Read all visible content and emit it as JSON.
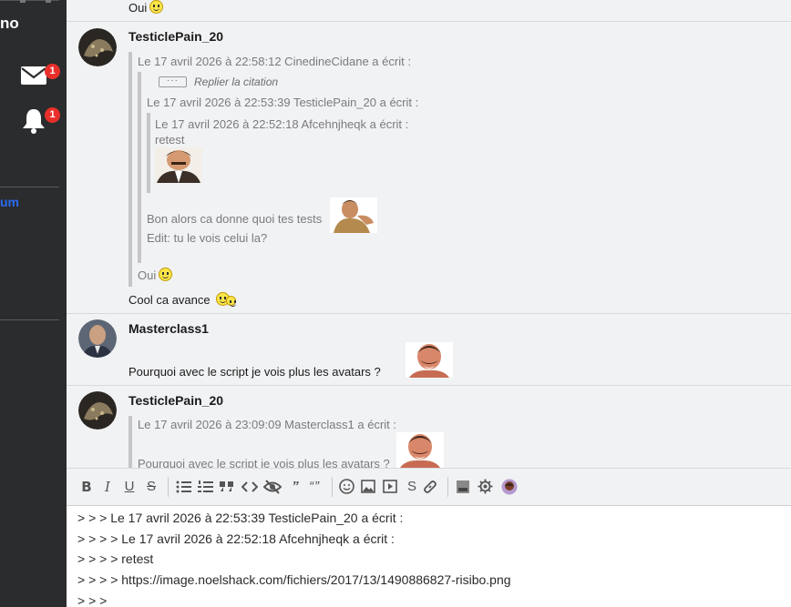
{
  "sidebar": {
    "title": "no",
    "mail_badge": "1",
    "notif_badge": "1",
    "link_label": "um"
  },
  "messages": [
    {
      "tail_text": "Oui"
    },
    {
      "author": "TesticlePain_20",
      "quote1_header": "Le 17 avril 2026 à 22:58:12 CinedineCidane a écrit :",
      "collapse_label": "Replier la citation",
      "collapse_button": "···",
      "quote2_header": "Le 17 avril 2026 à 22:53:39 TesticlePain_20 a écrit :",
      "quote3_header": "Le 17 avril 2026 à 22:52:18 Afcehnjheqk a écrit :",
      "quote3_text": "retest",
      "quote2_line1": "Bon alors ca donne quoi tes tests",
      "quote2_line2": "Edit: tu le vois celui la?",
      "quote1_tail": "Oui",
      "body": "Cool ca avance"
    },
    {
      "author": "Masterclass1",
      "body": "Pourquoi avec le script je vois plus les avatars ?"
    },
    {
      "author": "TesticlePain_20",
      "quote_header": "Le 17 avril 2026 à 23:09:09 Masterclass1 a écrit :",
      "quote_text": "Pourquoi avec le script je vois plus les avatars ?"
    }
  ],
  "toolbar": {
    "bold": "B",
    "italic": "I",
    "underline": "U",
    "strike": "S",
    "spoiler_quote": "”",
    "quote": "“”",
    "s_button": "S"
  },
  "editor_lines": [
    "> > > Le 17 avril 2026 à 22:53:39 TesticlePain_20 a écrit :",
    "> > > > Le 17 avril 2026 à 22:52:18 Afcehnjheqk a écrit :",
    "> > > > retest",
    "> > > > https://image.noelshack.com/fichiers/2017/13/1490886827-risibo.png",
    "> > >"
  ]
}
